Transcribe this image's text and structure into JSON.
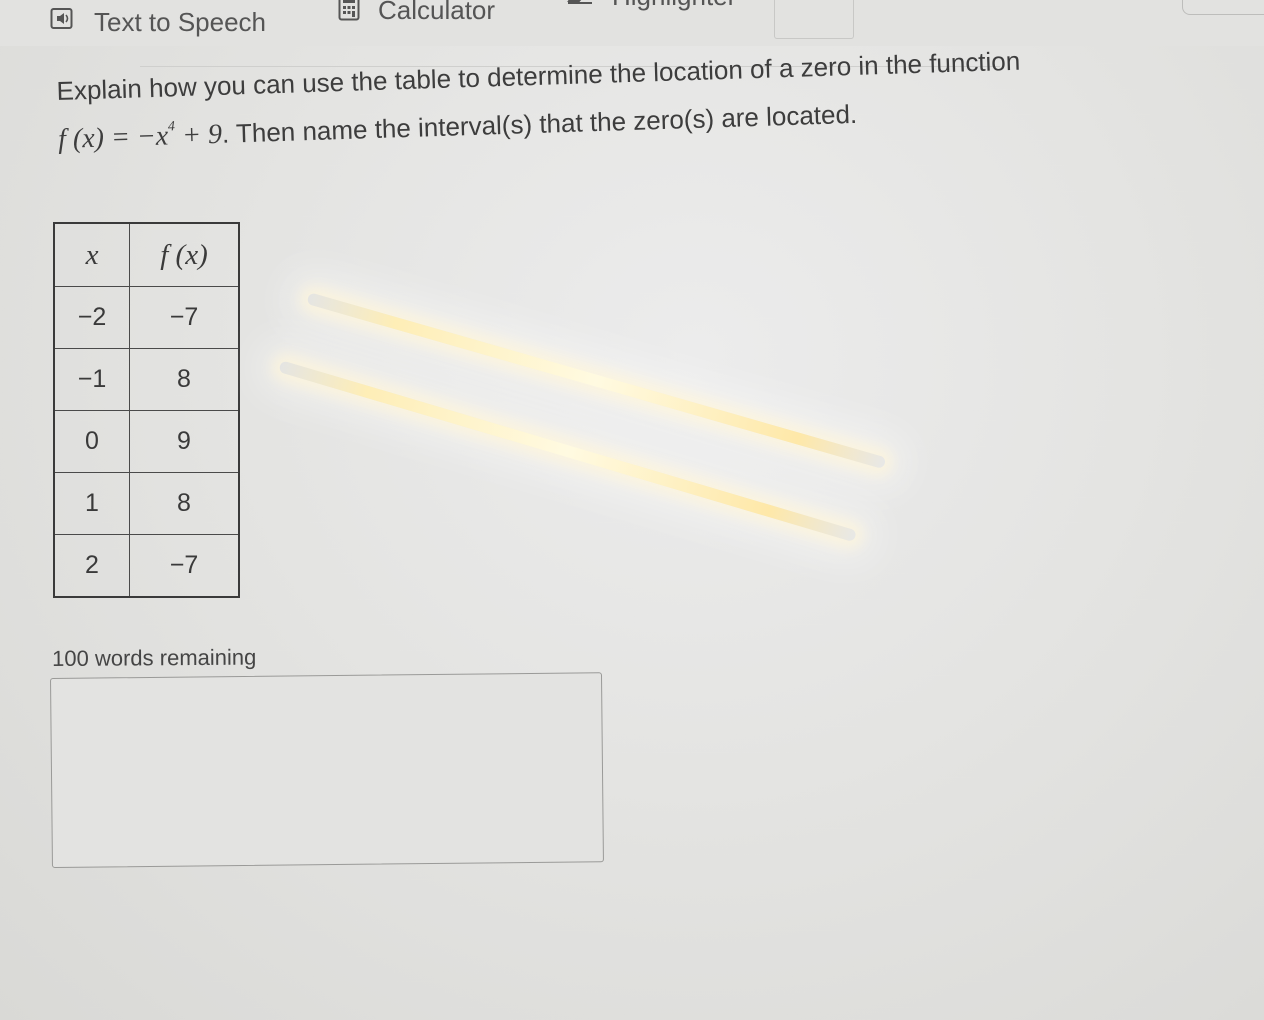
{
  "toolbar": {
    "text_to_speech_label": "Text to Speech",
    "calculator_label": "Calculator",
    "highlighter_label": "Highlighter"
  },
  "question": {
    "line1": "Explain how you can use the table to determine the location of a zero in the function",
    "function_lhs": "f (x) = −x",
    "function_exp": "4",
    "function_rhs": " + 9",
    "line2_rest": ". Then name the interval(s) that the zero(s) are located."
  },
  "table": {
    "headers": [
      "x",
      "f (x)"
    ],
    "rows": [
      [
        "−2",
        "−7"
      ],
      [
        "−1",
        "8"
      ],
      [
        "0",
        "9"
      ],
      [
        "1",
        "8"
      ],
      [
        "2",
        "−7"
      ]
    ]
  },
  "response": {
    "words_remaining": "100 words remaining",
    "value": ""
  }
}
